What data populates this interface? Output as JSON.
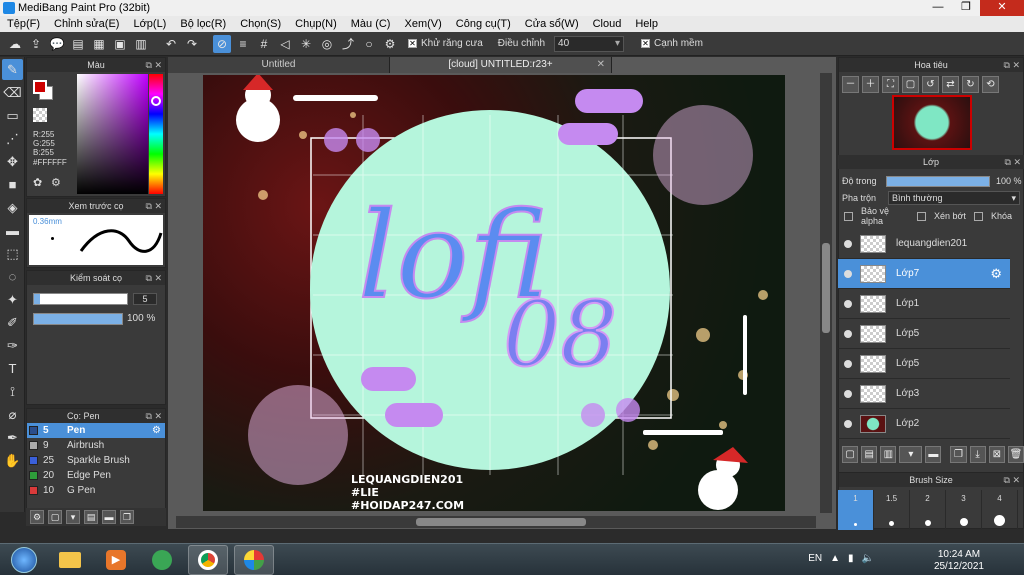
{
  "window": {
    "title": "MediBang Paint Pro (32bit)"
  },
  "menu": [
    "Tệp(F)",
    "Chỉnh sửa(E)",
    "Lớp(L)",
    "Bộ lọc(R)",
    "Chọn(S)",
    "Chụp(N)",
    "Màu (C)",
    "Xem(V)",
    "Công cụ(T)",
    "Cửa sổ(W)",
    "Cloud",
    "Help"
  ],
  "toolbar": {
    "antialias_label": "Khử răng cưa",
    "adjust_label": "Điều chỉnh",
    "adjust_value": "40",
    "soft_edge_label": "Cạnh mềm"
  },
  "color_panel": {
    "title": "Màu",
    "r": "R:255",
    "g": "G:255",
    "b": "B:255",
    "hex": "#FFFFFF",
    "fg_color": "#cc0000"
  },
  "preview_panel": {
    "title": "Xem trước cọ",
    "size": "0.36mm"
  },
  "control_panel": {
    "title": "Kiểm soát cọ",
    "size_value": "5",
    "opacity_value": "100 %"
  },
  "brush_panel": {
    "title": "Cọ: Pen",
    "items": [
      {
        "num": "5",
        "name": "Pen",
        "color": "#2b4e8c"
      },
      {
        "num": "9",
        "name": "Airbrush",
        "color": "#aaaaaa"
      },
      {
        "num": "25",
        "name": "Sparkle Brush",
        "color": "#3a5fd9"
      },
      {
        "num": "20",
        "name": "Edge Pen",
        "color": "#2e9c3a"
      },
      {
        "num": "10",
        "name": "G Pen",
        "color": "#d93a3a"
      }
    ]
  },
  "tabs": [
    {
      "label": "Untitled"
    },
    {
      "label": "[cloud] UNTITLED:r23+"
    }
  ],
  "artwork": {
    "title": "lofi",
    "subtitle": "08",
    "credit1": "LEQUANGDIEN201",
    "credit2": "#LIE",
    "credit3": "#HOIDAP247.COM"
  },
  "navigator": {
    "title": "Hoa tiêu"
  },
  "layers_panel": {
    "title": "Lớp",
    "opacity_label": "Độ trong",
    "opacity_value": "100 %",
    "blend_label": "Pha trộn",
    "blend_value": "Bình thường",
    "protect_alpha": "Bảo vệ alpha",
    "clipping": "Xén bớt",
    "lock": "Khóa",
    "layers": [
      {
        "name": "lequangdien201"
      },
      {
        "name": "Lớp7"
      },
      {
        "name": "Lớp1"
      },
      {
        "name": "Lớp5"
      },
      {
        "name": "Lớp5"
      },
      {
        "name": "Lớp3"
      },
      {
        "name": "Lớp2"
      }
    ]
  },
  "brush_size": {
    "title": "Brush Size",
    "sizes": [
      "1",
      "1.5",
      "2",
      "3",
      "4"
    ]
  },
  "taskbar": {
    "lang": "EN",
    "time": "10:24 AM",
    "date": "25/12/2021"
  },
  "colors": {
    "accent": "#4a90d9",
    "panel": "#3a3a3a"
  }
}
